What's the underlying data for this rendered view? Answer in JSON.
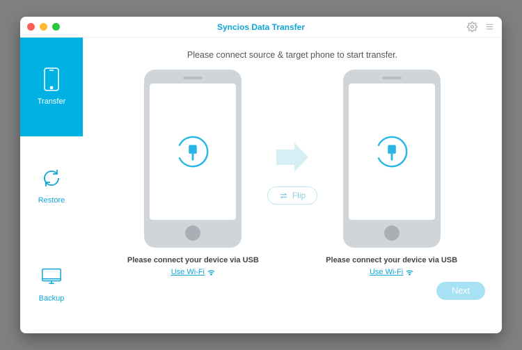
{
  "titlebar": {
    "title": "Syncios Data Transfer"
  },
  "sidebar": {
    "items": [
      {
        "label": "Transfer"
      },
      {
        "label": "Restore"
      },
      {
        "label": "Backup"
      }
    ]
  },
  "main": {
    "instruction": "Please connect source & target phone to start transfer.",
    "flip_label": "Flip",
    "next_label": "Next",
    "source": {
      "status": "Please connect your device via USB",
      "wifi_label": "Use Wi-Fi"
    },
    "target": {
      "status": "Please connect your device via USB",
      "wifi_label": "Use Wi-Fi"
    }
  }
}
